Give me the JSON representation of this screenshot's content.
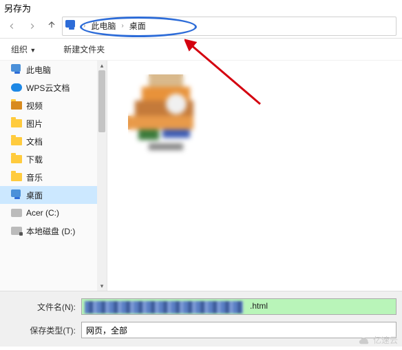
{
  "window": {
    "title": "另存为"
  },
  "breadcrumb": {
    "items": [
      "此电脑",
      "桌面"
    ]
  },
  "toolbar": {
    "organize": "组织",
    "newfolder": "新建文件夹"
  },
  "sidebar": {
    "items": [
      {
        "label": "此电脑",
        "icon": "monitor"
      },
      {
        "label": "WPS云文档",
        "icon": "cloud"
      },
      {
        "label": "视频",
        "icon": "folder"
      },
      {
        "label": "图片",
        "icon": "folder"
      },
      {
        "label": "文档",
        "icon": "folder"
      },
      {
        "label": "下载",
        "icon": "folder"
      },
      {
        "label": "音乐",
        "icon": "folder"
      },
      {
        "label": "桌面",
        "icon": "monitor",
        "selected": true
      },
      {
        "label": "Acer (C:)",
        "icon": "disk"
      },
      {
        "label": "本地磁盘 (D:)",
        "icon": "disk-ext"
      }
    ]
  },
  "form": {
    "filename_label": "文件名(N):",
    "filename_ext": ".html",
    "filetype_label": "保存类型(T):",
    "filetype_value": "网页，全部"
  },
  "watermark": "亿速云"
}
